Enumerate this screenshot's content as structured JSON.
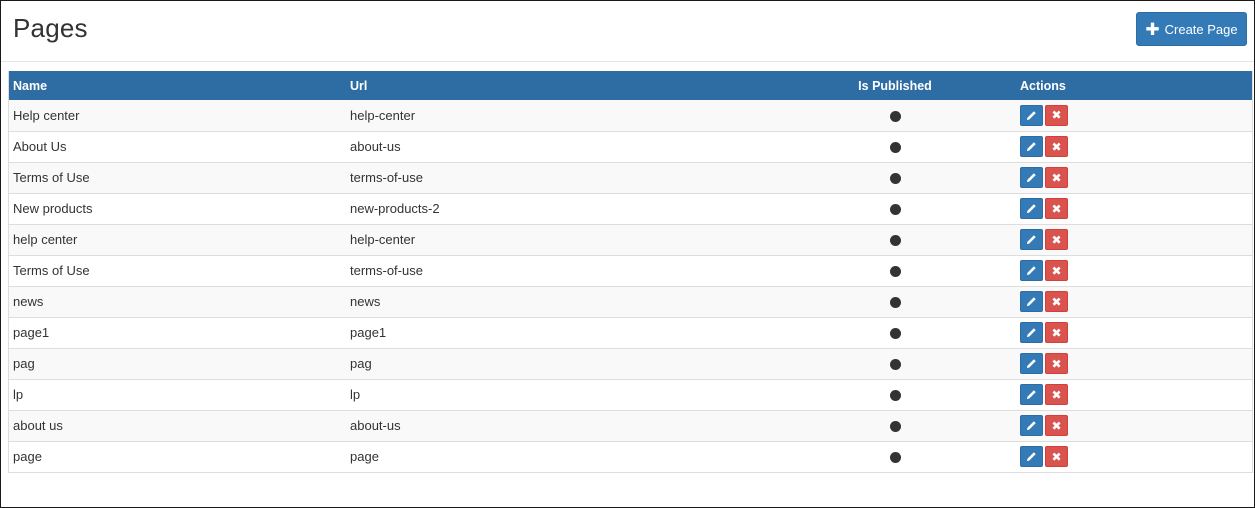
{
  "header": {
    "title": "Pages",
    "create_label": "Create Page",
    "create_icon": "plus-icon"
  },
  "table": {
    "columns": [
      "Name",
      "Url",
      "Is Published",
      "Actions"
    ],
    "rows": [
      {
        "name": "Help center",
        "url": "help-center",
        "published": true
      },
      {
        "name": "About Us",
        "url": "about-us",
        "published": true
      },
      {
        "name": "Terms of Use",
        "url": "terms-of-use",
        "published": true
      },
      {
        "name": "New products",
        "url": "new-products-2",
        "published": true
      },
      {
        "name": "help center",
        "url": "help-center",
        "published": true
      },
      {
        "name": "Terms of Use",
        "url": "terms-of-use",
        "published": true
      },
      {
        "name": "news",
        "url": "news",
        "published": true
      },
      {
        "name": "page1",
        "url": "page1",
        "published": true
      },
      {
        "name": "pag",
        "url": "pag",
        "published": true
      },
      {
        "name": "lp",
        "url": "lp",
        "published": true
      },
      {
        "name": "about us",
        "url": "about-us",
        "published": true
      },
      {
        "name": "page",
        "url": "page",
        "published": true
      }
    ],
    "action_icons": {
      "edit": "pencil-icon",
      "delete": "close-icon"
    }
  },
  "colors": {
    "primary": "#337ab7",
    "header_bg": "#2e6da4",
    "danger": "#d9534f",
    "published_dot": "#333333"
  }
}
